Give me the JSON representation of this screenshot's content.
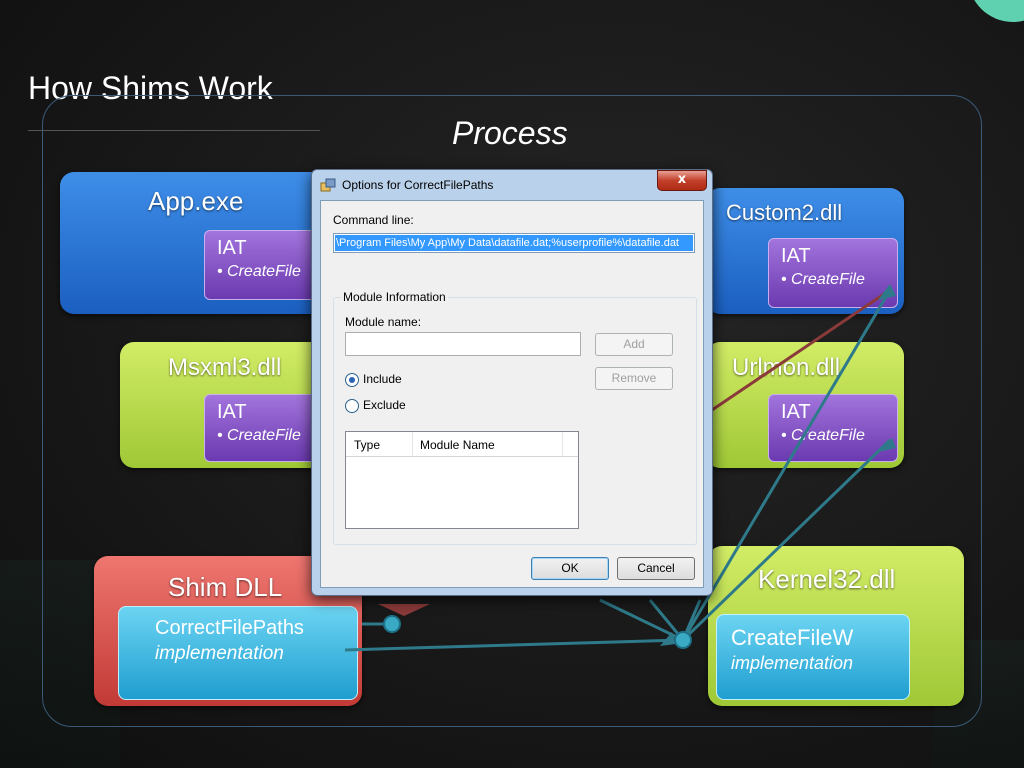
{
  "slide": {
    "title": "How Shims Work",
    "process_label": "Process"
  },
  "panels": {
    "app": {
      "title": "App.exe",
      "iat_title": "IAT",
      "iat_item": "• CreateFile"
    },
    "custom2": {
      "title": "Custom2.dll",
      "iat_title": "IAT",
      "iat_item": "• CreateFile"
    },
    "msxml3": {
      "title": "Msxml3.dll",
      "iat_title": "IAT",
      "iat_item": "• CreateFile"
    },
    "urlmon": {
      "title": "Urlmon.dll",
      "iat_title": "IAT",
      "iat_item": "• CreateFile"
    },
    "shim": {
      "title": "Shim DLL",
      "box_title": "CorrectFilePaths",
      "box_sub": "implementation"
    },
    "kernel32": {
      "title": "Kernel32.dll",
      "box_title": "CreateFileW",
      "box_sub": "implementation"
    }
  },
  "dialog": {
    "title": "Options for CorrectFilePaths",
    "close_label": "x",
    "command_line_label": "Command line:",
    "command_line_value": "\\Program Files\\My App\\My Data\\datafile.dat;%userprofile%\\datafile.dat",
    "group_label": "Module Information",
    "module_name_label": "Module name:",
    "module_name_value": "",
    "add_label": "Add",
    "remove_label": "Remove",
    "include_label": "Include",
    "exclude_label": "Exclude",
    "radio_selected": "include",
    "list_columns": [
      "Type",
      "Module Name"
    ],
    "ok_label": "OK",
    "cancel_label": "Cancel"
  },
  "colors": {
    "blue_panel": "#2f78d8",
    "green_panel": "#b8dc48",
    "red_panel": "#d9534f",
    "iat": "#8a55c8",
    "cyan_box": "#3cb8e4",
    "arrow_teal": "#2e7a8a",
    "arrow_red": "#8b3a3a"
  }
}
